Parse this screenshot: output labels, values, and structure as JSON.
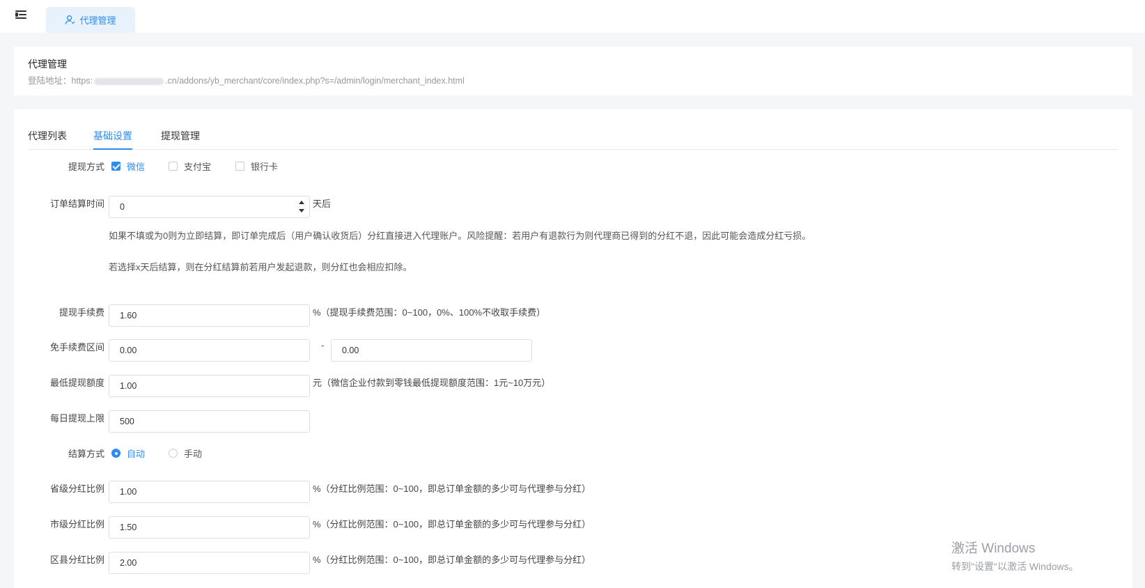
{
  "header": {
    "tab_label": "代理管理",
    "tab_icon": "user-icon"
  },
  "info": {
    "title": "代理管理",
    "url_prefix": "登陆地址：https:",
    "url_suffix": ".cn/addons/yb_merchant/core/index.php?s=/admin/login/merchant_index.html"
  },
  "tabs": [
    {
      "label": "代理列表",
      "active": false
    },
    {
      "label": "基础设置",
      "active": true
    },
    {
      "label": "提现管理",
      "active": false
    }
  ],
  "form": {
    "withdraw_method": {
      "label": "提现方式",
      "options": [
        {
          "label": "微信",
          "checked": true
        },
        {
          "label": "支付宝",
          "checked": false
        },
        {
          "label": "银行卡",
          "checked": false
        }
      ]
    },
    "settle_time": {
      "label": "订单结算时间",
      "value": "0",
      "suffix": "天后",
      "note1": "如果不填或为0则为立即结算，即订单完成后（用户确认收货后）分红直接进入代理账户。风险提醒：若用户有退款行为则代理商已得到的分红不退，因此可能会造成分红亏损。",
      "note2": "若选择x天后结算，则在分红结算前若用户发起退款，则分红也会相应扣除。"
    },
    "fee": {
      "label": "提现手续费",
      "value": "1.60",
      "suffix": "%（提现手续费范围：0~100，0%、100%不收取手续费）"
    },
    "free_range": {
      "label": "免手续费区间",
      "min": "0.00",
      "separator": "-",
      "max": "0.00"
    },
    "min_withdraw": {
      "label": "最低提现额度",
      "value": "1.00",
      "suffix": "元（微信企业付款到零钱最低提现额度范围：1元~10万元）"
    },
    "daily_limit": {
      "label": "每日提现上限",
      "value": "500"
    },
    "settle_mode": {
      "label": "结算方式",
      "options": [
        {
          "label": "自动",
          "checked": true
        },
        {
          "label": "手动",
          "checked": false
        }
      ]
    },
    "province_ratio": {
      "label": "省级分红比例",
      "value": "1.00",
      "suffix": "%（分红比例范围：0~100，即总订单金额的多少可与代理参与分红）"
    },
    "city_ratio": {
      "label": "市级分红比例",
      "value": "1.50",
      "suffix": "%（分红比例范围：0~100，即总订单金额的多少可与代理参与分红）"
    },
    "county_ratio": {
      "label": "区县分红比例",
      "value": "2.00",
      "suffix": "%（分红比例范围：0~100，即总订单金额的多少可与代理参与分红）"
    }
  },
  "watermark": {
    "line1": "激活 Windows",
    "line2": "转到\"设置\"以激活 Windows。"
  },
  "colors": {
    "accent": "#2d8cf0",
    "background": "#f5f6f8"
  }
}
